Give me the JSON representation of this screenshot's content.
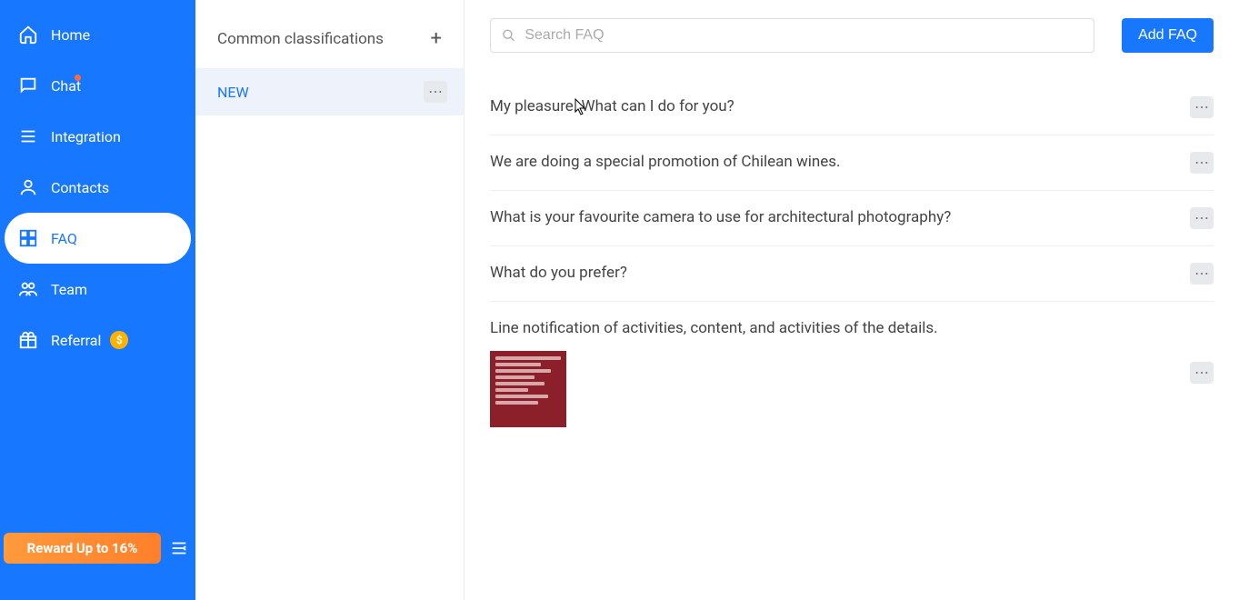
{
  "sidebar": {
    "items": [
      {
        "label": "Home",
        "icon": "home"
      },
      {
        "label": "Chat",
        "icon": "chat",
        "badge": true
      },
      {
        "label": "Integration",
        "icon": "integration"
      },
      {
        "label": "Contacts",
        "icon": "contact"
      },
      {
        "label": "FAQ",
        "icon": "faq",
        "active": true
      },
      {
        "label": "Team",
        "icon": "team"
      },
      {
        "label": "Referral",
        "icon": "gift",
        "coin": true
      }
    ],
    "reward": "Reward Up to 16%"
  },
  "panel": {
    "title": "Common classifications",
    "items": [
      {
        "label": "NEW",
        "selected": true
      }
    ]
  },
  "toolbar": {
    "search_placeholder": "Search FAQ",
    "add_label": "Add FAQ"
  },
  "faqs": [
    {
      "text": "My pleasure. What can I do for you?"
    },
    {
      "text": "We are doing a special promotion of Chilean wines."
    },
    {
      "text": "What is your favourite camera to use for architectural photography?"
    },
    {
      "text": "What do you prefer?"
    },
    {
      "text": "Line notification of activities, content, and activities of the details.",
      "thumb": true
    }
  ]
}
